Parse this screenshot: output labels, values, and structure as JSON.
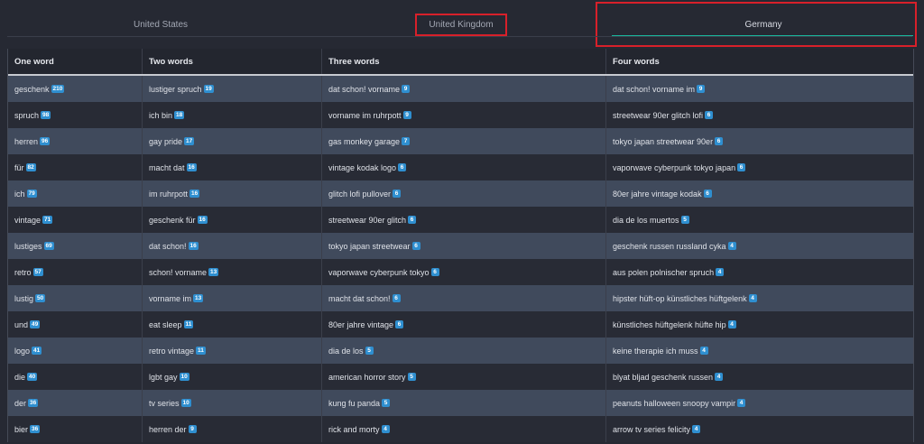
{
  "tabs": {
    "us": "United States",
    "uk": "United Kingdom",
    "de": "Germany"
  },
  "table": {
    "headers": [
      "One word",
      "Two words",
      "Three words",
      "Four words"
    ],
    "rows": [
      [
        [
          "geschenk",
          "210"
        ],
        [
          "lustiger spruch",
          "19"
        ],
        [
          "dat schon! vorname",
          "9"
        ],
        [
          "dat schon! vorname im",
          "9"
        ]
      ],
      [
        [
          "spruch",
          "98"
        ],
        [
          "ich bin",
          "18"
        ],
        [
          "vorname im ruhrpott",
          "9"
        ],
        [
          "streetwear 90er glitch lofi",
          "6"
        ]
      ],
      [
        [
          "herren",
          "96"
        ],
        [
          "gay pride",
          "17"
        ],
        [
          "gas monkey garage",
          "7"
        ],
        [
          "tokyo japan streetwear 90er",
          "6"
        ]
      ],
      [
        [
          "für",
          "82"
        ],
        [
          "macht dat",
          "16"
        ],
        [
          "vintage kodak logo",
          "6"
        ],
        [
          "vaporwave cyberpunk tokyo japan",
          "6"
        ]
      ],
      [
        [
          "ich",
          "79"
        ],
        [
          "im ruhrpott",
          "16"
        ],
        [
          "glitch lofi pullover",
          "6"
        ],
        [
          "80er jahre vintage kodak",
          "6"
        ]
      ],
      [
        [
          "vintage",
          "71"
        ],
        [
          "geschenk für",
          "16"
        ],
        [
          "streetwear 90er glitch",
          "6"
        ],
        [
          "dia de los muertos",
          "5"
        ]
      ],
      [
        [
          "lustiges",
          "69"
        ],
        [
          "dat schon!",
          "16"
        ],
        [
          "tokyo japan streetwear",
          "6"
        ],
        [
          "geschenk russen russland cyka",
          "4"
        ]
      ],
      [
        [
          "retro",
          "57"
        ],
        [
          "schon! vorname",
          "13"
        ],
        [
          "vaporwave cyberpunk tokyo",
          "6"
        ],
        [
          "aus polen polnischer spruch",
          "4"
        ]
      ],
      [
        [
          "lustig",
          "50"
        ],
        [
          "vorname im",
          "13"
        ],
        [
          "macht dat schon!",
          "6"
        ],
        [
          "hipster hüft-op künstliches hüftgelenk",
          "4"
        ]
      ],
      [
        [
          "und",
          "49"
        ],
        [
          "eat sleep",
          "11"
        ],
        [
          "80er jahre vintage",
          "6"
        ],
        [
          "künstliches hüftgelenk hüfte hip",
          "4"
        ]
      ],
      [
        [
          "logo",
          "41"
        ],
        [
          "retro vintage",
          "11"
        ],
        [
          "dia de los",
          "5"
        ],
        [
          "keine therapie ich muss",
          "4"
        ]
      ],
      [
        [
          "die",
          "40"
        ],
        [
          "lgbt gay",
          "10"
        ],
        [
          "american horror story",
          "5"
        ],
        [
          "blyat bljad geschenk russen",
          "4"
        ]
      ],
      [
        [
          "der",
          "36"
        ],
        [
          "tv series",
          "10"
        ],
        [
          "kung fu panda",
          "5"
        ],
        [
          "peanuts halloween snoopy vampir",
          "4"
        ]
      ],
      [
        [
          "bier",
          "36"
        ],
        [
          "herren der",
          "9"
        ],
        [
          "rick and morty",
          "4"
        ],
        [
          "arrow tv series felicity",
          "4"
        ]
      ]
    ]
  },
  "colors": {
    "background": "#262933",
    "row_alt": "#404a5c",
    "badge": "#2f8fd0",
    "highlight_box": "#d8202a",
    "active_underline": "#18b99e"
  }
}
